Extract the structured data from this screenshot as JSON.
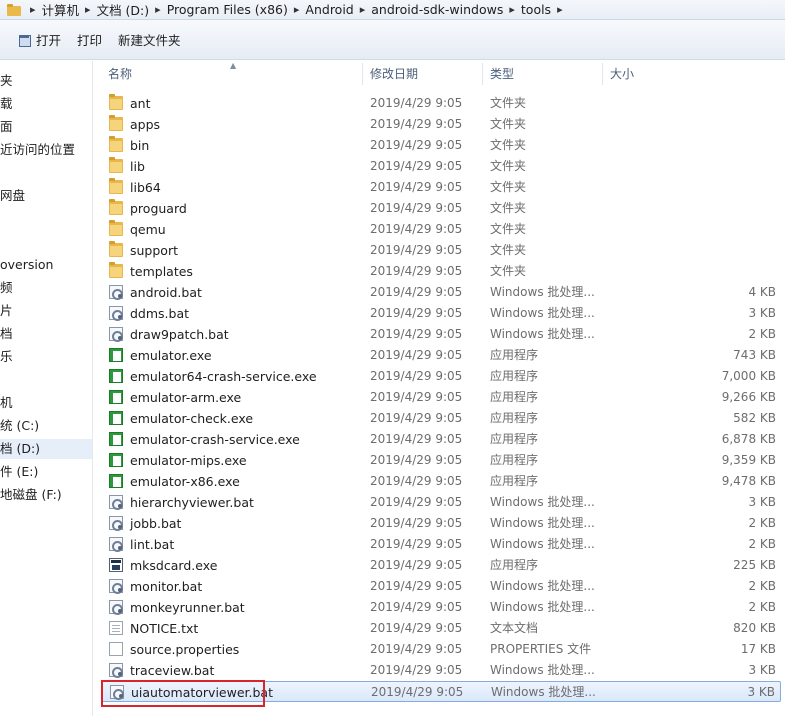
{
  "breadcrumb": {
    "items": [
      "计算机",
      "文档 (D:)",
      "Program Files (x86)",
      "Android",
      "android-sdk-windows",
      "tools"
    ],
    "separator": "▸"
  },
  "toolbar": {
    "open_label": "打开",
    "print_label": "打印",
    "new_folder_label": "新建文件夹"
  },
  "nav": {
    "items": [
      "夹",
      "载",
      "面",
      "近访问的位置",
      "网盘",
      "oversion",
      "频",
      "片",
      "档",
      "乐",
      "机",
      "统 (C:)",
      "档 (D:)",
      "件 (E:)",
      "地磁盘 (F:)"
    ],
    "selected_index": 12
  },
  "columns": {
    "name": "名称",
    "date": "修改日期",
    "type": "类型",
    "size": "大小"
  },
  "files": [
    {
      "name": "ant",
      "date": "2019/4/29 9:05",
      "type": "文件夹",
      "size": "",
      "icon": "folder-icon"
    },
    {
      "name": "apps",
      "date": "2019/4/29 9:05",
      "type": "文件夹",
      "size": "",
      "icon": "folder-icon"
    },
    {
      "name": "bin",
      "date": "2019/4/29 9:05",
      "type": "文件夹",
      "size": "",
      "icon": "folder-icon"
    },
    {
      "name": "lib",
      "date": "2019/4/29 9:05",
      "type": "文件夹",
      "size": "",
      "icon": "folder-icon"
    },
    {
      "name": "lib64",
      "date": "2019/4/29 9:05",
      "type": "文件夹",
      "size": "",
      "icon": "folder-icon"
    },
    {
      "name": "proguard",
      "date": "2019/4/29 9:05",
      "type": "文件夹",
      "size": "",
      "icon": "folder-icon"
    },
    {
      "name": "qemu",
      "date": "2019/4/29 9:05",
      "type": "文件夹",
      "size": "",
      "icon": "folder-icon"
    },
    {
      "name": "support",
      "date": "2019/4/29 9:05",
      "type": "文件夹",
      "size": "",
      "icon": "folder-icon"
    },
    {
      "name": "templates",
      "date": "2019/4/29 9:05",
      "type": "文件夹",
      "size": "",
      "icon": "folder-icon"
    },
    {
      "name": "android.bat",
      "date": "2019/4/29 9:05",
      "type": "Windows 批处理...",
      "size": "4 KB",
      "icon": "bat-icon"
    },
    {
      "name": "ddms.bat",
      "date": "2019/4/29 9:05",
      "type": "Windows 批处理...",
      "size": "3 KB",
      "icon": "bat-icon"
    },
    {
      "name": "draw9patch.bat",
      "date": "2019/4/29 9:05",
      "type": "Windows 批处理...",
      "size": "2 KB",
      "icon": "bat-icon"
    },
    {
      "name": "emulator.exe",
      "date": "2019/4/29 9:05",
      "type": "应用程序",
      "size": "743 KB",
      "icon": "exe-icon"
    },
    {
      "name": "emulator64-crash-service.exe",
      "date": "2019/4/29 9:05",
      "type": "应用程序",
      "size": "7,000 KB",
      "icon": "exe-icon"
    },
    {
      "name": "emulator-arm.exe",
      "date": "2019/4/29 9:05",
      "type": "应用程序",
      "size": "9,266 KB",
      "icon": "exe-icon"
    },
    {
      "name": "emulator-check.exe",
      "date": "2019/4/29 9:05",
      "type": "应用程序",
      "size": "582 KB",
      "icon": "exe-icon"
    },
    {
      "name": "emulator-crash-service.exe",
      "date": "2019/4/29 9:05",
      "type": "应用程序",
      "size": "6,878 KB",
      "icon": "exe-icon"
    },
    {
      "name": "emulator-mips.exe",
      "date": "2019/4/29 9:05",
      "type": "应用程序",
      "size": "9,359 KB",
      "icon": "exe-icon"
    },
    {
      "name": "emulator-x86.exe",
      "date": "2019/4/29 9:05",
      "type": "应用程序",
      "size": "9,478 KB",
      "icon": "exe-icon"
    },
    {
      "name": "hierarchyviewer.bat",
      "date": "2019/4/29 9:05",
      "type": "Windows 批处理...",
      "size": "3 KB",
      "icon": "bat-icon"
    },
    {
      "name": "jobb.bat",
      "date": "2019/4/29 9:05",
      "type": "Windows 批处理...",
      "size": "2 KB",
      "icon": "bat-icon"
    },
    {
      "name": "lint.bat",
      "date": "2019/4/29 9:05",
      "type": "Windows 批处理...",
      "size": "2 KB",
      "icon": "bat-icon"
    },
    {
      "name": "mksdcard.exe",
      "date": "2019/4/29 9:05",
      "type": "应用程序",
      "size": "225 KB",
      "icon": "exe-icon-dark"
    },
    {
      "name": "monitor.bat",
      "date": "2019/4/29 9:05",
      "type": "Windows 批处理...",
      "size": "2 KB",
      "icon": "bat-icon"
    },
    {
      "name": "monkeyrunner.bat",
      "date": "2019/4/29 9:05",
      "type": "Windows 批处理...",
      "size": "2 KB",
      "icon": "bat-icon"
    },
    {
      "name": "NOTICE.txt",
      "date": "2019/4/29 9:05",
      "type": "文本文档",
      "size": "820 KB",
      "icon": "txt-icon"
    },
    {
      "name": "source.properties",
      "date": "2019/4/29 9:05",
      "type": "PROPERTIES 文件",
      "size": "17 KB",
      "icon": "file-icon"
    },
    {
      "name": "traceview.bat",
      "date": "2019/4/29 9:05",
      "type": "Windows 批处理...",
      "size": "3 KB",
      "icon": "bat-icon"
    },
    {
      "name": "uiautomatorviewer.bat",
      "date": "2019/4/29 9:05",
      "type": "Windows 批处理...",
      "size": "3 KB",
      "icon": "bat-icon"
    }
  ],
  "selected_file_index": 28,
  "colors": {
    "selection_border": "#84acdd",
    "annotation_box": "#d8252c",
    "folder": "#e8b64a"
  }
}
